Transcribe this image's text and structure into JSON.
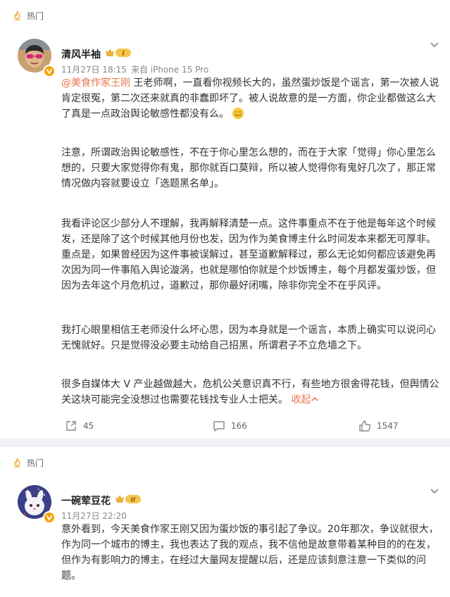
{
  "posts": [
    {
      "hot_label": "热门",
      "username": "清风半袖",
      "level": "I",
      "meta": {
        "date": "11月27日 18:15",
        "source": "来自 iPhone 15 Pro"
      },
      "mention": "@美食作家王刚",
      "paragraphs": [
        " 王老师啊，一直看你视频长大的，虽然蛋炒饭是个谣言，第一次被人说肯定很冤，第二次还来就真的非蠢即坏了。被人说故意的是一方面，你企业都做这么大了真是一点政治舆论敏感性都没有么。",
        "注意，所谓政治舆论敏感性，不在于你心里怎么想的，而在于大家「觉得」你心里怎么想的，只要大家觉得你有鬼，那你就百口莫辩，所以被人觉得你有鬼好几次了，那正常情况做内容就要设立「选题黑名单」。",
        "我看评论区少部分人不理解，我再解释清楚一点。这件事重点不在于他是每年这个时候发，还是除了这个时候其他月份也发，因为作为美食博主什么时间发本来都无可厚非。\n重点是，如果曾经因为这件事被误解过，甚至道歉解释过，那么无论如何都应该避免再次因为同一件事陷入舆论漩涡，也就是哪怕你就是个炒饭博主，每个月都发蛋炒饭，但因为去年这个月危机过，道歉过，那你最好闭嘴，除非你完全不在乎风评。",
        "我打心眼里相信王老师没什么坏心思，因为本身就是一个谣言，本质上确实可以说问心无愧就好。只是觉得没必要主动给自己招黑，所谓君子不立危墙之下。",
        "很多自媒体大 V 产业越做越大，危机公关意识真不行，有些地方很舍得花钱，但舆情公关这块可能完全没想过也需要花钱找专业人士把关。"
      ],
      "collapse_label": "收起",
      "actions": {
        "share": "45",
        "comment": "166",
        "like": "1547"
      }
    },
    {
      "hot_label": "热门",
      "username": "一碗荤豆花",
      "level": "II",
      "meta": {
        "date": "11月27日 22:20"
      },
      "paragraphs": [
        "意外看到，今天美食作家王刚又因为蛋炒饭的事引起了争议。20年那次，争议就很大，作为同一个城市的博主，我也表达了我的观点，我不信他是故意带着某种目的的在发，但作为有影响力的博主，在经过大量网友提醒以后，还是应该刻意注意一下类似的问题。"
      ]
    }
  ],
  "colors": {
    "accent": "#eb7350",
    "badge": "#f7a30c",
    "crown": "#e8b340"
  }
}
